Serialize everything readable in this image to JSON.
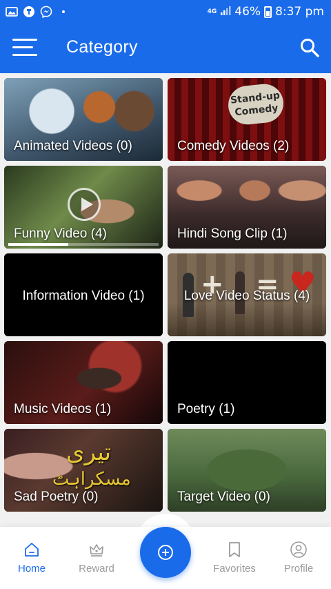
{
  "status_bar": {
    "network": "4G",
    "battery": "46%",
    "time": "8:37 pm",
    "icons": [
      "image-icon",
      "notification-app-icon",
      "messenger-icon",
      "dot-icon",
      "signal-icon",
      "battery-icon"
    ]
  },
  "app_bar": {
    "title": "Category",
    "menu_icon": "menu-icon",
    "search_icon": "search-icon"
  },
  "categories": [
    {
      "label": "Animated Videos (0)"
    },
    {
      "label": "Comedy Videos (2)"
    },
    {
      "label": "Funny Video (4)"
    },
    {
      "label": "Hindi Song Clip (1)"
    },
    {
      "label": "Information Video (1)"
    },
    {
      "label": "Love Video Status (4)"
    },
    {
      "label": "Music Videos (1)"
    },
    {
      "label": "Poetry (1)"
    },
    {
      "label": "Sad Poetry (0)"
    },
    {
      "label": "Target Video (0)"
    }
  ],
  "thumbnail_text": {
    "comedy_sign": "Stand-up Comedy",
    "sad_urdu_line1": "تیری",
    "sad_urdu_line2": "مسکراہٹ"
  },
  "bottom_nav": {
    "items": [
      {
        "label": "Home",
        "icon": "home-icon",
        "active": true
      },
      {
        "label": "Reward",
        "icon": "reward-icon",
        "active": false
      },
      {
        "label": "Favorites",
        "icon": "bookmark-icon",
        "active": false
      },
      {
        "label": "Profile",
        "icon": "profile-icon",
        "active": false
      }
    ],
    "fab_icon": "add-circle-icon"
  },
  "colors": {
    "primary": "#1a6bea",
    "nav_inactive": "#9a9a9a",
    "background": "#f1f1f1"
  }
}
